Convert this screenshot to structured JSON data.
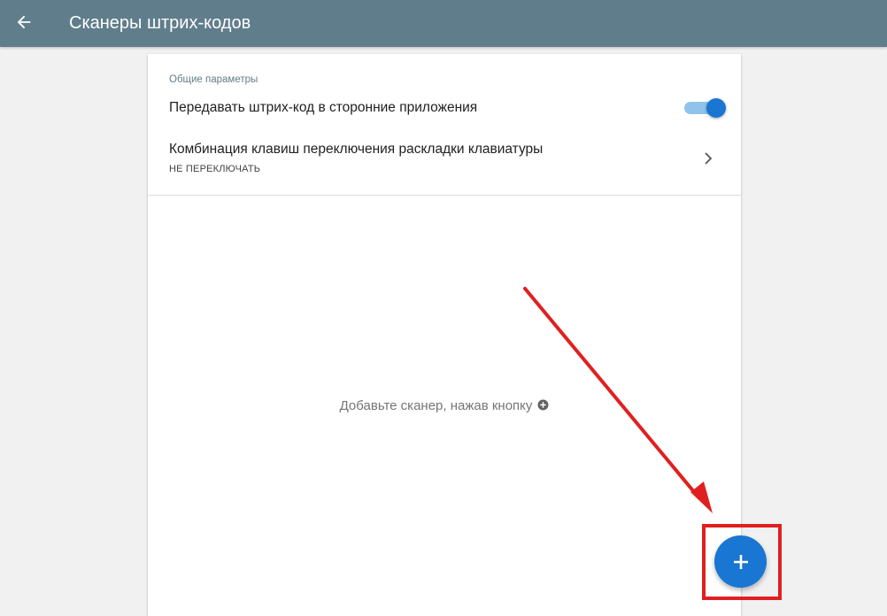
{
  "appbar": {
    "title": "Сканеры штрих-кодов",
    "back_icon": "arrow-back-icon",
    "color": "#607d8b"
  },
  "settings": {
    "section_title": "Общие параметры",
    "pass_barcode": {
      "label": "Передавать штрих-код в сторонние приложения",
      "enabled": true
    },
    "keyboard_layout": {
      "label": "Комбинация клавиш переключения раскладки клавиатуры",
      "value": "НЕ ПЕРЕКЛЮЧАТЬ",
      "icon": "chevron-right-icon"
    }
  },
  "empty_state": {
    "text": "Добавьте сканер, нажав кнопку",
    "icon": "add-circle-icon"
  },
  "fab": {
    "icon": "plus-icon",
    "color": "#1976d2"
  },
  "annotation": {
    "color": "#e02020"
  }
}
